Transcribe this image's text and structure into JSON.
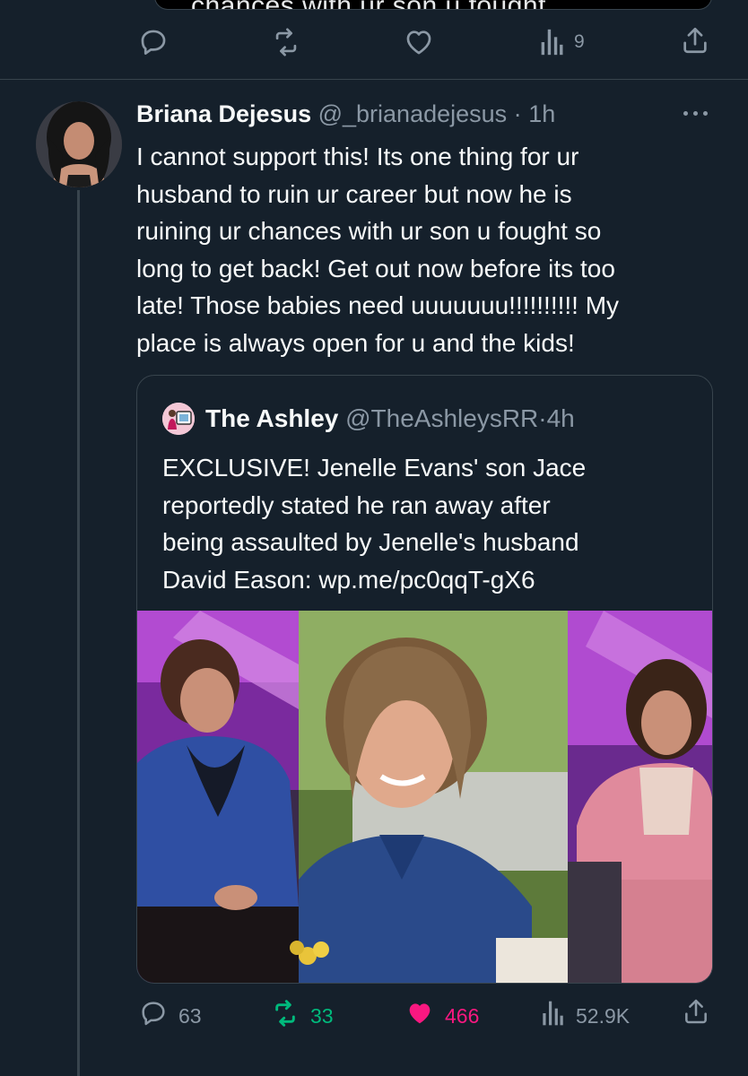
{
  "prev_tweet": {
    "cut_text": "chances with ur son u fought",
    "stats": {
      "views": "9"
    }
  },
  "tweet": {
    "author_name": "Briana Dejesus",
    "author_handle": "@_brianadejesus",
    "time": "1h",
    "text": "I cannot support this! Its one thing for ur\nhusband to ruin ur career but now he is\nruining ur chances with ur son u fought so\nlong to get back! Get out now before its too\nlate! Those babies need uuuuuuu!!!!!!!!!! My\nplace is always open for u and the kids!",
    "stats": {
      "replies": "63",
      "retweets": "33",
      "likes": "466",
      "views": "52.9K"
    },
    "colors": {
      "retweet": "#00ba7c",
      "like": "#f91880",
      "muted": "#8b98a5"
    }
  },
  "quoted": {
    "author_name": "The Ashley",
    "author_handle": "@TheAshleysRR",
    "time": "4h",
    "text": "EXCLUSIVE! Jenelle Evans' son Jace\nreportedly stated he ran away after\nbeing assaulted by Jenelle's husband\nDavid Eason: wp.me/pc0qqT-gX6"
  },
  "icons": [
    "reply-icon",
    "retweet-icon",
    "like-icon",
    "views-icon",
    "share-icon",
    "more-icon"
  ]
}
